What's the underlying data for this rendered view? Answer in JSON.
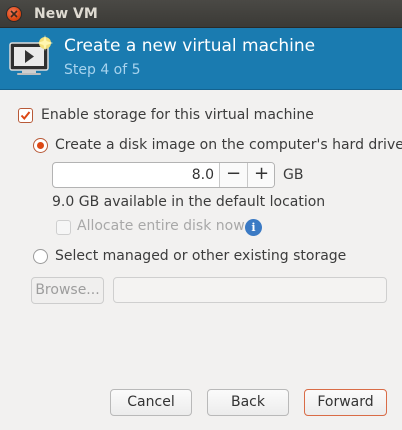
{
  "window": {
    "title": "New VM"
  },
  "header": {
    "title": "Create a new virtual machine",
    "step": "Step 4 of 5"
  },
  "storage": {
    "enable_label": "Enable storage for this virtual machine",
    "enable_checked": true,
    "create_disk_label": "Create a disk image on the computer's hard drive",
    "create_disk_selected": true,
    "size_value": "8.0",
    "size_decrement": "−",
    "size_increment": "+",
    "size_unit": "GB",
    "available_text": "9.0 GB available in the default location",
    "allocate_label": "Allocate entire disk now",
    "allocate_checked": false,
    "info_glyph": "i",
    "managed_label": "Select managed or other existing storage",
    "managed_selected": false,
    "browse_label": "Browse...",
    "path_value": ""
  },
  "buttons": {
    "cancel": "Cancel",
    "back": "Back",
    "forward": "Forward"
  },
  "colors": {
    "header_bg": "#1a7bb0",
    "accent": "#dd4814",
    "step_text": "#a7d3ee"
  }
}
